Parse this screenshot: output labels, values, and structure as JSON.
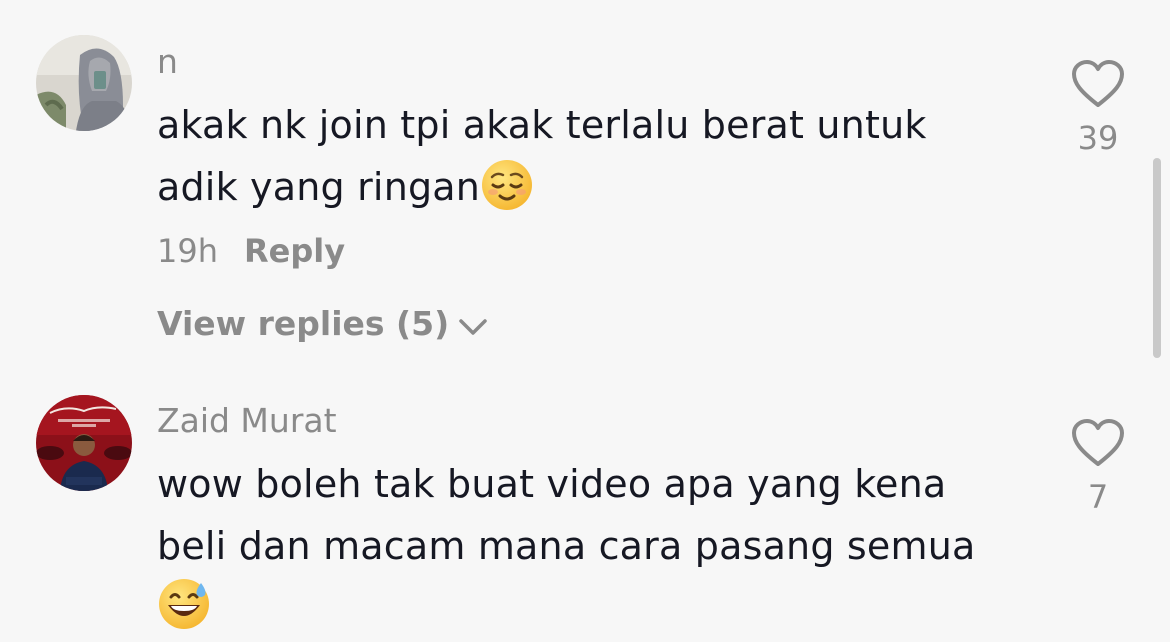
{
  "comments": [
    {
      "username": "n",
      "text_line1": "akak nk join tpi akak terlalu berat untuk",
      "text_line2": "adik yang ringan",
      "emoji": "relieved-face",
      "time": "19h",
      "reply_label": "Reply",
      "view_replies_label": "View replies (5)",
      "like_count": "39"
    },
    {
      "username": "Zaid Murat",
      "text_line1": "wow boleh tak buat video apa yang kena",
      "text_line2": "beli dan macam mana cara pasang semua",
      "emoji": "grinning-face-with-sweat",
      "like_count": "7"
    }
  ],
  "colors": {
    "background": "#f7f7f7",
    "text": "#161823",
    "muted": "#8a8a8a"
  }
}
